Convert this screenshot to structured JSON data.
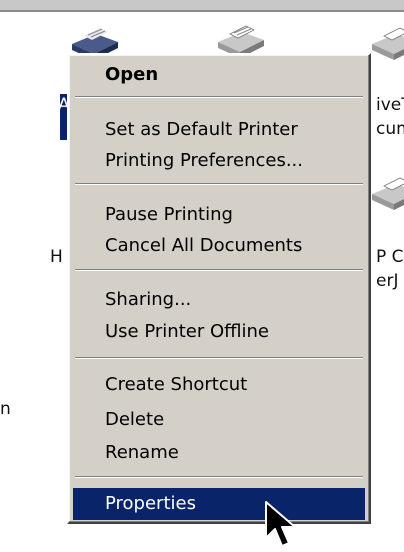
{
  "desktop": {
    "label_left_a": "A",
    "label_left_h": "H",
    "label_left_n": "n",
    "label_right_1": "iveT",
    "label_right_2": "cum",
    "label_right_3": "P C",
    "label_right_4": "erJ"
  },
  "context_menu": {
    "items": [
      {
        "label": "Open",
        "bold": true
      },
      {
        "label": "Set as Default Printer"
      },
      {
        "label": "Printing Preferences..."
      },
      {
        "label": "Pause Printing"
      },
      {
        "label": "Cancel All Documents"
      },
      {
        "label": "Sharing..."
      },
      {
        "label": "Use Printer Offline"
      },
      {
        "label": "Create Shortcut"
      },
      {
        "label": "Delete"
      },
      {
        "label": "Rename"
      },
      {
        "label": "Properties",
        "highlighted": true
      }
    ]
  },
  "colors": {
    "menu_bg": "#d4d0c8",
    "highlight": "#0a246a",
    "highlight_text": "#ffffff"
  },
  "icons": {
    "printer": "printer-icon",
    "cursor": "mouse-pointer-icon"
  }
}
